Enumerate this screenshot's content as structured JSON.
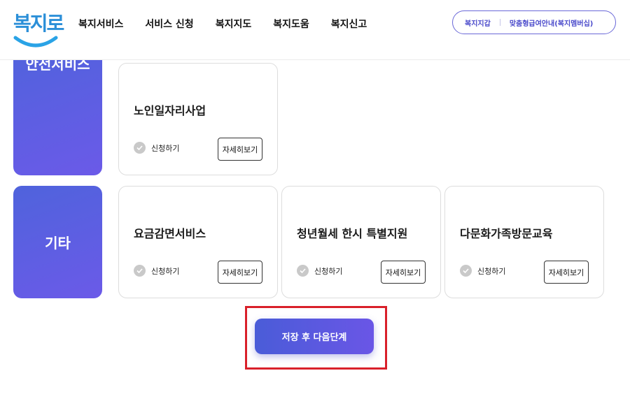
{
  "header": {
    "logo_text": "복지로",
    "nav": [
      "복지서비스",
      "서비스 신청",
      "복지지도",
      "복지도움",
      "복지신고"
    ],
    "pill_links": [
      "복지지갑",
      "맞춤형급여안내(복지멤버십)"
    ]
  },
  "categories": [
    {
      "label": "안전서비스",
      "cards": [
        {
          "title": "노인일자리사업",
          "apply": "신청하기",
          "detail": "자세히보기"
        }
      ]
    },
    {
      "label": "기타",
      "cards": [
        {
          "title": "요금감면서비스",
          "apply": "신청하기",
          "detail": "자세히보기"
        },
        {
          "title": "청년월세 한시 특별지원",
          "apply": "신청하기",
          "detail": "자세히보기"
        },
        {
          "title": "다문화가족방문교육",
          "apply": "신청하기",
          "detail": "자세히보기"
        }
      ]
    }
  ],
  "save_button": {
    "label": "저장 후 다음단계"
  },
  "colors": {
    "brand_blue": "#2b8fd8",
    "accent_purple": "#6a56e6",
    "highlight_red": "#d9202a"
  }
}
